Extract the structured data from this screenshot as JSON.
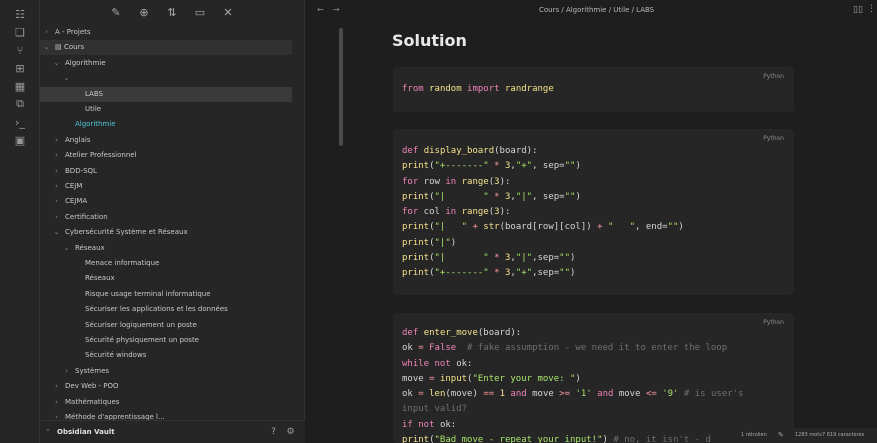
{
  "ribbon": {
    "icons": [
      "book-icon",
      "files-icon",
      "graph-icon",
      "grid-icon",
      "calendar-icon",
      "copy-icon",
      "terminal-icon",
      "slides-icon"
    ]
  },
  "sidebar": {
    "toolbar_icons": [
      "edit-icon",
      "new-folder-icon",
      "sort-icon",
      "collapse-icon",
      "close-icon"
    ],
    "tree": [
      {
        "label": "A - Projets",
        "chev": "›",
        "indent": 0
      },
      {
        "label": "Cours",
        "chev": "⌄",
        "indent": 0,
        "folder_icon": "▤",
        "selected": true
      },
      {
        "label": "Algorithmie",
        "chev": "⌄",
        "indent": 1
      },
      {
        "label": "",
        "chev": "⌄",
        "indent": 2,
        "purple": true
      },
      {
        "label": "LABS",
        "chev": "",
        "indent": 3,
        "selected": true
      },
      {
        "label": "Utile",
        "chev": "",
        "indent": 3
      },
      {
        "label": "Algorithmie",
        "chev": "",
        "indent": 2,
        "accent": true
      },
      {
        "label": "Anglais",
        "chev": "›",
        "indent": 1
      },
      {
        "label": "Atelier Professionnel",
        "chev": "›",
        "indent": 1
      },
      {
        "label": "BDD-SQL",
        "chev": "›",
        "indent": 1
      },
      {
        "label": "CEJM",
        "chev": "›",
        "indent": 1
      },
      {
        "label": "CEJMA",
        "chev": "›",
        "indent": 1
      },
      {
        "label": "Certification",
        "chev": "›",
        "indent": 1
      },
      {
        "label": "Cybersécurité Système et Réseaux",
        "chev": "⌄",
        "indent": 1
      },
      {
        "label": "Réseaux",
        "chev": "⌄",
        "indent": 2
      },
      {
        "label": "Menace informatique",
        "chev": "",
        "indent": 3
      },
      {
        "label": "Réseaux",
        "chev": "",
        "indent": 3
      },
      {
        "label": "Risque usage terminal informatique",
        "chev": "",
        "indent": 3
      },
      {
        "label": "Sécuriser les applications et les données",
        "chev": "",
        "indent": 3
      },
      {
        "label": "Sécuriser logiquement un poste",
        "chev": "",
        "indent": 3
      },
      {
        "label": "Sécurité physiquement un poste",
        "chev": "",
        "indent": 3
      },
      {
        "label": "Sécurité windows",
        "chev": "",
        "indent": 3
      },
      {
        "label": "Systèmes",
        "chev": "›",
        "indent": 2
      },
      {
        "label": "Dev Web - POO",
        "chev": "›",
        "indent": 1
      },
      {
        "label": "Mathématiques",
        "chev": "›",
        "indent": 1
      },
      {
        "label": "Méthode d'apprentissage l...",
        "chev": "›",
        "indent": 1
      }
    ],
    "vault_name": "Obsidian Vault",
    "vault_chev": "⌃",
    "help_icon": "?",
    "settings_icon": "⚙"
  },
  "topbar": {
    "back": "←",
    "forward": "→",
    "breadcrumb": "Cours / Algorithmie / Utile / LABS",
    "book_icon": "▯▯",
    "more_icon": "⋮"
  },
  "note": {
    "title": "Solution",
    "blocks": [
      {
        "lang": "Python",
        "lines": [
          [
            [
              "k",
              "from"
            ],
            [
              "p",
              " "
            ],
            [
              "n",
              "random"
            ],
            [
              "p",
              " "
            ],
            [
              "k",
              "import"
            ],
            [
              "p",
              " "
            ],
            [
              "n",
              "randrange"
            ]
          ]
        ]
      },
      {
        "lang": "Python",
        "lines": [
          [
            [
              "k",
              "def"
            ],
            [
              "p",
              " "
            ],
            [
              "fn",
              "display_board"
            ],
            [
              "p",
              "(board):"
            ]
          ],
          [
            [
              "fn",
              "print"
            ],
            [
              "p",
              "("
            ],
            [
              "s",
              "\"+-------\""
            ],
            [
              "p",
              " "
            ],
            [
              "o",
              "*"
            ],
            [
              "p",
              " "
            ],
            [
              "n",
              "3"
            ],
            [
              "p",
              ","
            ],
            [
              "s",
              "\"+\""
            ],
            [
              "p",
              ", sep="
            ],
            [
              "s",
              "\"\""
            ],
            [
              "p",
              ")"
            ]
          ],
          [
            [
              "k",
              "for"
            ],
            [
              "p",
              " row "
            ],
            [
              "k",
              "in"
            ],
            [
              "p",
              " "
            ],
            [
              "fn",
              "range"
            ],
            [
              "p",
              "("
            ],
            [
              "n",
              "3"
            ],
            [
              "p",
              "):"
            ]
          ],
          [
            [
              "fn",
              "print"
            ],
            [
              "p",
              "("
            ],
            [
              "s",
              "\"|       \""
            ],
            [
              "p",
              " "
            ],
            [
              "o",
              "*"
            ],
            [
              "p",
              " "
            ],
            [
              "n",
              "3"
            ],
            [
              "p",
              ","
            ],
            [
              "s",
              "\"|\""
            ],
            [
              "p",
              ", sep="
            ],
            [
              "s",
              "\"\""
            ],
            [
              "p",
              ")"
            ]
          ],
          [
            [
              "k",
              "for"
            ],
            [
              "p",
              " col "
            ],
            [
              "k",
              "in"
            ],
            [
              "p",
              " "
            ],
            [
              "fn",
              "range"
            ],
            [
              "p",
              "("
            ],
            [
              "n",
              "3"
            ],
            [
              "p",
              "):"
            ]
          ],
          [
            [
              "fn",
              "print"
            ],
            [
              "p",
              "("
            ],
            [
              "s",
              "\"|   \""
            ],
            [
              "p",
              " "
            ],
            [
              "o",
              "+"
            ],
            [
              "p",
              " "
            ],
            [
              "fn",
              "str"
            ],
            [
              "p",
              "(board[row][col]) "
            ],
            [
              "o",
              "+"
            ],
            [
              "p",
              " "
            ],
            [
              "s",
              "\"   \""
            ],
            [
              "p",
              ", end="
            ],
            [
              "s",
              "\"\""
            ],
            [
              "p",
              ")"
            ]
          ],
          [
            [
              "fn",
              "print"
            ],
            [
              "p",
              "("
            ],
            [
              "s",
              "\"|\""
            ],
            [
              "p",
              ")"
            ]
          ],
          [
            [
              "fn",
              "print"
            ],
            [
              "p",
              "("
            ],
            [
              "s",
              "\"|       \""
            ],
            [
              "p",
              " "
            ],
            [
              "o",
              "*"
            ],
            [
              "p",
              " "
            ],
            [
              "n",
              "3"
            ],
            [
              "p",
              ","
            ],
            [
              "s",
              "\"|\""
            ],
            [
              "p",
              ",sep="
            ],
            [
              "s",
              "\"\""
            ],
            [
              "p",
              ")"
            ]
          ],
          [
            [
              "fn",
              "print"
            ],
            [
              "p",
              "("
            ],
            [
              "s",
              "\"+-------\""
            ],
            [
              "p",
              " "
            ],
            [
              "o",
              "*"
            ],
            [
              "p",
              " "
            ],
            [
              "n",
              "3"
            ],
            [
              "p",
              ","
            ],
            [
              "s",
              "\"+\""
            ],
            [
              "p",
              ",sep="
            ],
            [
              "s",
              "\"\""
            ],
            [
              "p",
              ")"
            ]
          ]
        ]
      },
      {
        "lang": "Python",
        "lines": [
          [
            [
              "k",
              "def"
            ],
            [
              "p",
              " "
            ],
            [
              "fn",
              "enter_move"
            ],
            [
              "p",
              "(board):"
            ]
          ],
          [
            [
              "p",
              "ok "
            ],
            [
              "o",
              "="
            ],
            [
              "p",
              " "
            ],
            [
              "k",
              "False"
            ],
            [
              "p",
              "  "
            ],
            [
              "c",
              "# fake assumption - we need it to enter the loop"
            ]
          ],
          [
            [
              "k",
              "while"
            ],
            [
              "p",
              " "
            ],
            [
              "k",
              "not"
            ],
            [
              "p",
              " ok:"
            ]
          ],
          [
            [
              "p",
              "move "
            ],
            [
              "o",
              "="
            ],
            [
              "p",
              " "
            ],
            [
              "fn",
              "input"
            ],
            [
              "p",
              "("
            ],
            [
              "s",
              "\"Enter your move: \""
            ],
            [
              "p",
              ")"
            ]
          ],
          [
            [
              "p",
              "ok "
            ],
            [
              "o",
              "="
            ],
            [
              "p",
              " "
            ],
            [
              "fn",
              "len"
            ],
            [
              "p",
              "(move) "
            ],
            [
              "o",
              "=="
            ],
            [
              "p",
              " "
            ],
            [
              "n",
              "1"
            ],
            [
              "p",
              " "
            ],
            [
              "k",
              "and"
            ],
            [
              "p",
              " move "
            ],
            [
              "o",
              ">="
            ],
            [
              "p",
              " "
            ],
            [
              "s",
              "'1'"
            ],
            [
              "p",
              " "
            ],
            [
              "k",
              "and"
            ],
            [
              "p",
              " move "
            ],
            [
              "o",
              "<="
            ],
            [
              "p",
              " "
            ],
            [
              "s",
              "'9'"
            ],
            [
              "p",
              " "
            ],
            [
              "c",
              "# is user's"
            ]
          ],
          [
            [
              "c",
              "input valid?"
            ]
          ],
          [
            [
              "k",
              "if"
            ],
            [
              "p",
              " "
            ],
            [
              "k",
              "not"
            ],
            [
              "p",
              " ok:"
            ]
          ],
          [
            [
              "fn",
              "print"
            ],
            [
              "p",
              "("
            ],
            [
              "s",
              "\"Bad move - repeat your input!\""
            ],
            [
              "p",
              ") "
            ],
            [
              "c",
              "# no, it isn't - d"
            ]
          ]
        ]
      }
    ]
  },
  "status": {
    "backlinks": "1 rétrolien",
    "pencil_icon": "✎",
    "words": "1283 mots",
    "chars": "7 819 caractères"
  }
}
